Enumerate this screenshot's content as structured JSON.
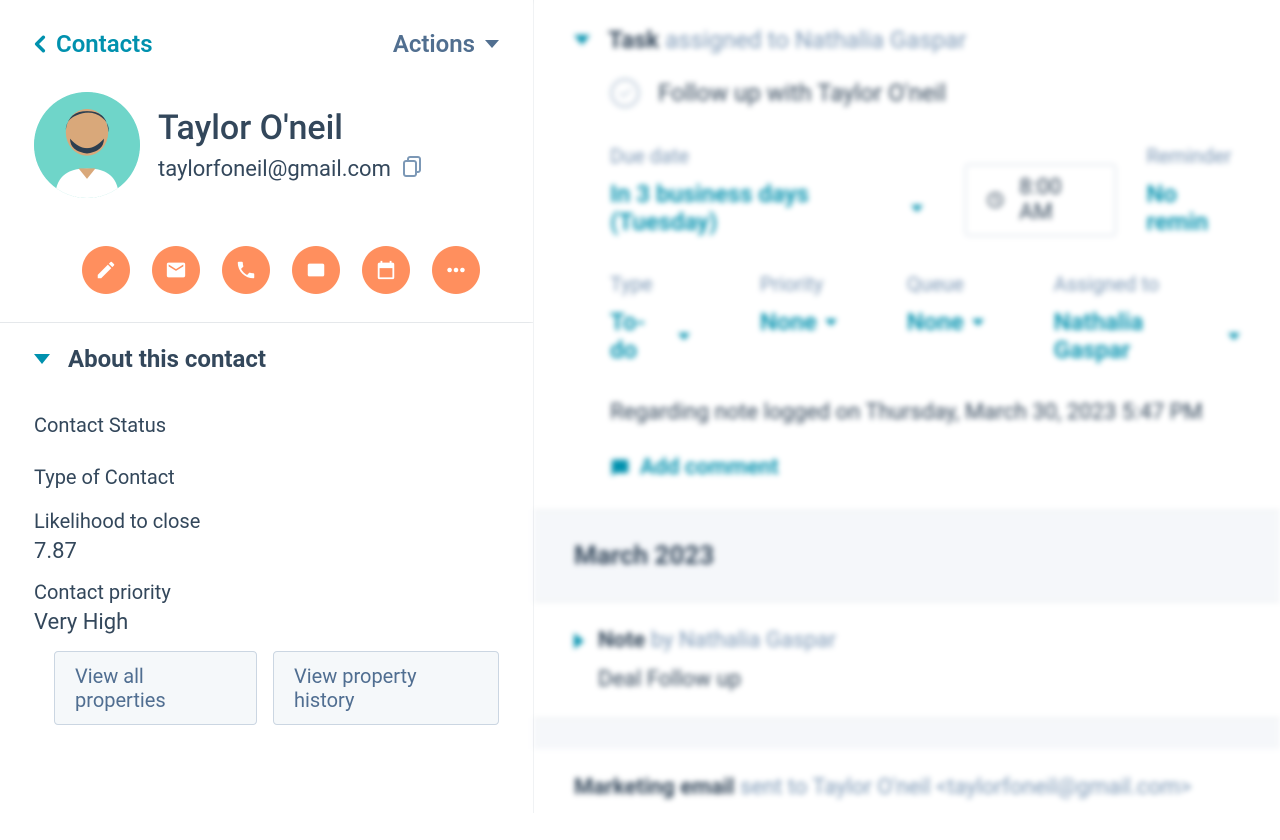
{
  "nav": {
    "back_label": "Contacts",
    "actions_label": "Actions"
  },
  "contact": {
    "name": "Taylor O'neil",
    "email": "taylorfoneil@gmail.com"
  },
  "about": {
    "section_title": "About this contact",
    "status_label": "Contact Status",
    "status_value": "",
    "type_label": "Type of Contact",
    "type_value": "",
    "likelihood_label": "Likelihood to close",
    "likelihood_value": "7.87",
    "priority_label": "Contact priority",
    "priority_value": "Very High",
    "view_all_label": "View all properties",
    "view_history_label": "View property history"
  },
  "timeline": {
    "task": {
      "header_prefix": "Task",
      "header_suffix": "assigned to Nathalia Gaspar",
      "item": "Follow up with Taylor O'neil",
      "due_date_label": "Due date",
      "due_date_value": "In 3 business days (Tuesday)",
      "time_value": "8:00 AM",
      "reminder_label": "Reminder",
      "reminder_value": "No remin",
      "type_label": "Type",
      "type_value": "To-do",
      "priority_label": "Priority",
      "priority_value": "None",
      "queue_label": "Queue",
      "queue_value": "None",
      "assigned_label": "Assigned to",
      "assigned_value": "Nathalia Gaspar",
      "regarding": "Regarding note logged on Thursday, March 30, 2023 5:47 PM",
      "add_comment": "Add comment"
    },
    "month": "March 2023",
    "note": {
      "header_prefix": "Note",
      "header_suffix": "by Nathalia Gaspar",
      "body": "Deal Follow up"
    },
    "email": {
      "header_prefix": "Marketing email",
      "header_suffix": "sent to Taylor O'neil <taylorfoneil@gmail.com>"
    }
  }
}
